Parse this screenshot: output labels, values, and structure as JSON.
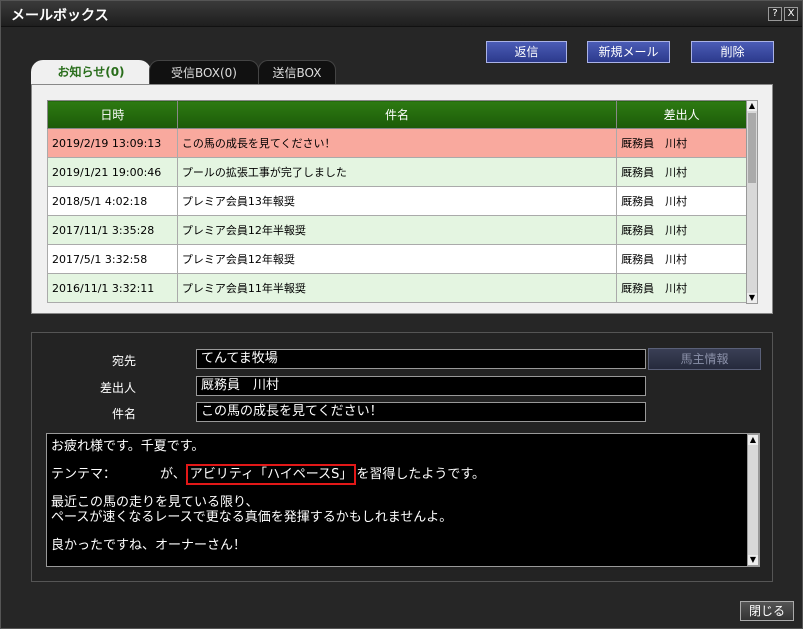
{
  "window": {
    "title": "メールボックス",
    "help_label": "?",
    "close_label": "X"
  },
  "toolbar": {
    "reply_label": "返信",
    "new_mail_label": "新規メール",
    "delete_label": "削除"
  },
  "tabs": [
    {
      "label": "お知らせ(0)"
    },
    {
      "label": "受信BOX(0)"
    },
    {
      "label": "送信BOX"
    }
  ],
  "table": {
    "headers": [
      "日時",
      "件名",
      "差出人"
    ],
    "rows": [
      {
        "date": "2019/2/19 13:09:13",
        "subject": "この馬の成長を見てください！",
        "sender": "厩務員　川村"
      },
      {
        "date": "2019/1/21 19:00:46",
        "subject": "プールの拡張工事が完了しました",
        "sender": "厩務員　川村"
      },
      {
        "date": "2018/5/1 4:02:18",
        "subject": "プレミア会員13年報奨",
        "sender": "厩務員　川村"
      },
      {
        "date": "2017/11/1 3:35:28",
        "subject": "プレミア会員12年半報奨",
        "sender": "厩務員　川村"
      },
      {
        "date": "2017/5/1 3:32:58",
        "subject": "プレミア会員12年報奨",
        "sender": "厩務員　川村"
      },
      {
        "date": "2016/11/1 3:32:11",
        "subject": "プレミア会員11年半報奨",
        "sender": "厩務員　川村"
      }
    ]
  },
  "detail": {
    "to_label": "宛先",
    "to_value": "てんてま牧場",
    "from_label": "差出人",
    "from_value": "厩務員　川村",
    "subject_label": "件名",
    "subject_value": "この馬の成長を見てください！",
    "owner_info_label": "馬主情報",
    "body": {
      "line1": "お疲れ様です。千夏です。",
      "line2_prefix": "テンテマ：",
      "line2_ga": "が、",
      "line2_highlight": "アビリティ「ハイペースS」",
      "line2_suffix": "を習得したようです。",
      "line3": "最近この馬の走りを見ている限り、",
      "line4": "ペースが速くなるレースで更なる真価を発揮するかもしれませんよ。",
      "line5": "良かったですね、オーナーさん！"
    }
  },
  "footer": {
    "close_label": "閉じる"
  },
  "colors": {
    "header_green": "#1c5a08",
    "selected_row": "#f9a99e",
    "even_row": "#e4f5e1",
    "highlight_red": "#e21818",
    "button_blue": "#2c3a8c"
  }
}
